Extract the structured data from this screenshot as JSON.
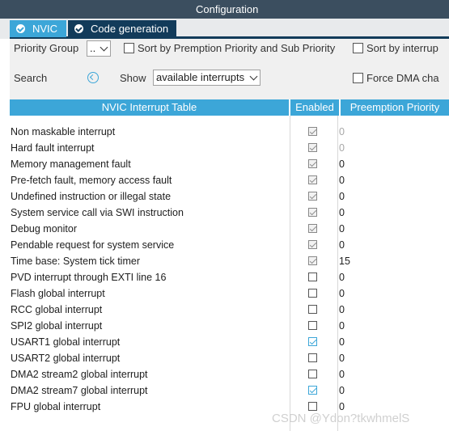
{
  "window": {
    "title": "Configuration"
  },
  "tabs": [
    {
      "label": "NVIC",
      "active": true
    },
    {
      "label": "Code generation",
      "active": false
    }
  ],
  "toolbar": {
    "priority_group_label": "Priority Group",
    "priority_group_value": "..",
    "sort_label": "Sort by Premption Priority and Sub Priority",
    "sort_interrupts_label": "Sort by interrup",
    "search_label": "Search",
    "show_label": "Show",
    "show_value": "available interrupts",
    "force_dma_label": "Force DMA cha"
  },
  "table": {
    "columns": [
      "NVIC Interrupt Table",
      "Enabled",
      "Preemption Priority"
    ],
    "rows": [
      {
        "name": "Non maskable interrupt",
        "enabled": true,
        "locked": true,
        "priority": "0"
      },
      {
        "name": "Hard fault interrupt",
        "enabled": true,
        "locked": true,
        "priority": "0"
      },
      {
        "name": "Memory management fault",
        "enabled": true,
        "locked": true,
        "priority": "0"
      },
      {
        "name": "Pre-fetch fault, memory access fault",
        "enabled": true,
        "locked": true,
        "priority": "0"
      },
      {
        "name": "Undefined instruction or illegal state",
        "enabled": true,
        "locked": true,
        "priority": "0"
      },
      {
        "name": "System service call via SWI instruction",
        "enabled": true,
        "locked": true,
        "priority": "0"
      },
      {
        "name": "Debug monitor",
        "enabled": true,
        "locked": true,
        "priority": "0"
      },
      {
        "name": "Pendable request for system service",
        "enabled": true,
        "locked": true,
        "priority": "0"
      },
      {
        "name": "Time base: System tick timer",
        "enabled": true,
        "locked": true,
        "priority": "15"
      },
      {
        "name": "PVD interrupt through EXTI line 16",
        "enabled": false,
        "locked": false,
        "priority": "0"
      },
      {
        "name": "Flash global interrupt",
        "enabled": false,
        "locked": false,
        "priority": "0"
      },
      {
        "name": "RCC global interrupt",
        "enabled": false,
        "locked": false,
        "priority": "0"
      },
      {
        "name": "SPI2 global interrupt",
        "enabled": false,
        "locked": false,
        "priority": "0"
      },
      {
        "name": "USART1 global interrupt",
        "enabled": true,
        "locked": false,
        "priority": "0"
      },
      {
        "name": "USART2 global interrupt",
        "enabled": false,
        "locked": false,
        "priority": "0"
      },
      {
        "name": "DMA2 stream2 global interrupt",
        "enabled": false,
        "locked": false,
        "priority": "0"
      },
      {
        "name": "DMA2 stream7 global interrupt",
        "enabled": true,
        "locked": false,
        "priority": "0"
      },
      {
        "name": "FPU global interrupt",
        "enabled": false,
        "locked": false,
        "priority": "0"
      }
    ]
  },
  "watermark": "CSDN @Ydon?tkwhmelS",
  "colors": {
    "header": "#3b4e5f",
    "accent": "#3ca6d8",
    "dark_tab": "#123b5a"
  }
}
